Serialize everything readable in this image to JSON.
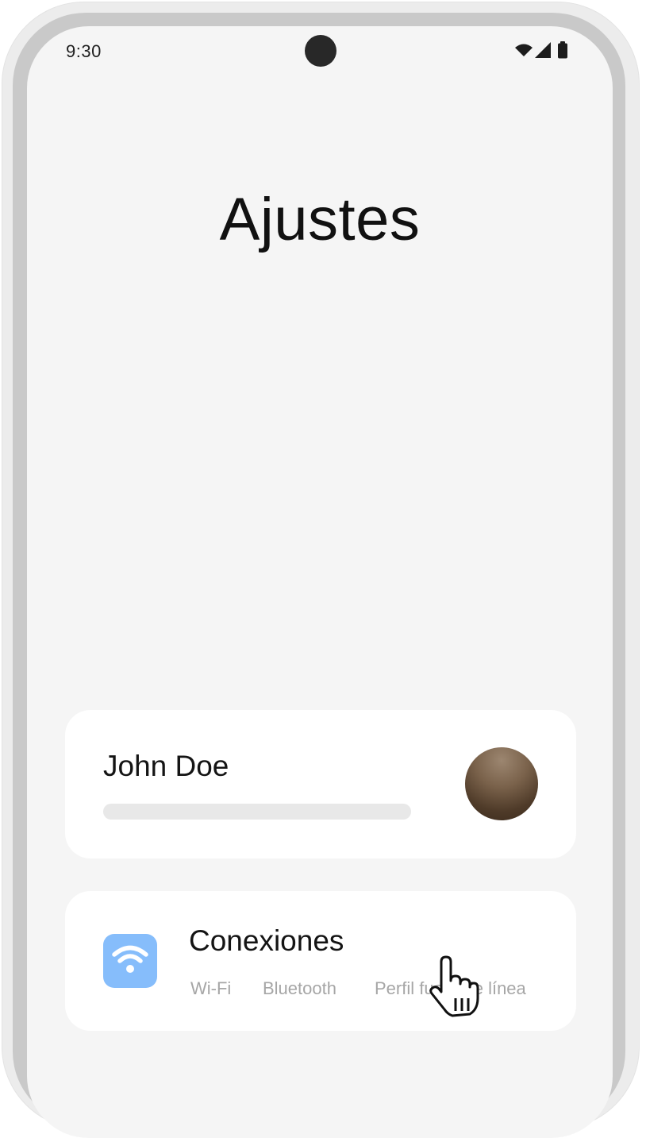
{
  "status_bar": {
    "time": "9:30",
    "icons": [
      "wifi-icon",
      "cellular-signal-icon",
      "battery-icon"
    ]
  },
  "page": {
    "title": "Ajustes"
  },
  "profile": {
    "name": "John Doe"
  },
  "connections": {
    "title": "Conexiones",
    "icon": "wifi-icon",
    "items": [
      "Wi-Fi",
      "Bluetooth",
      "Perfil fuera de línea"
    ]
  },
  "colors": {
    "screen_background": "#f5f5f5",
    "card_background": "#ffffff",
    "wifi_tile": "#86bdfb",
    "secondary_text": "#a6a6a6"
  }
}
